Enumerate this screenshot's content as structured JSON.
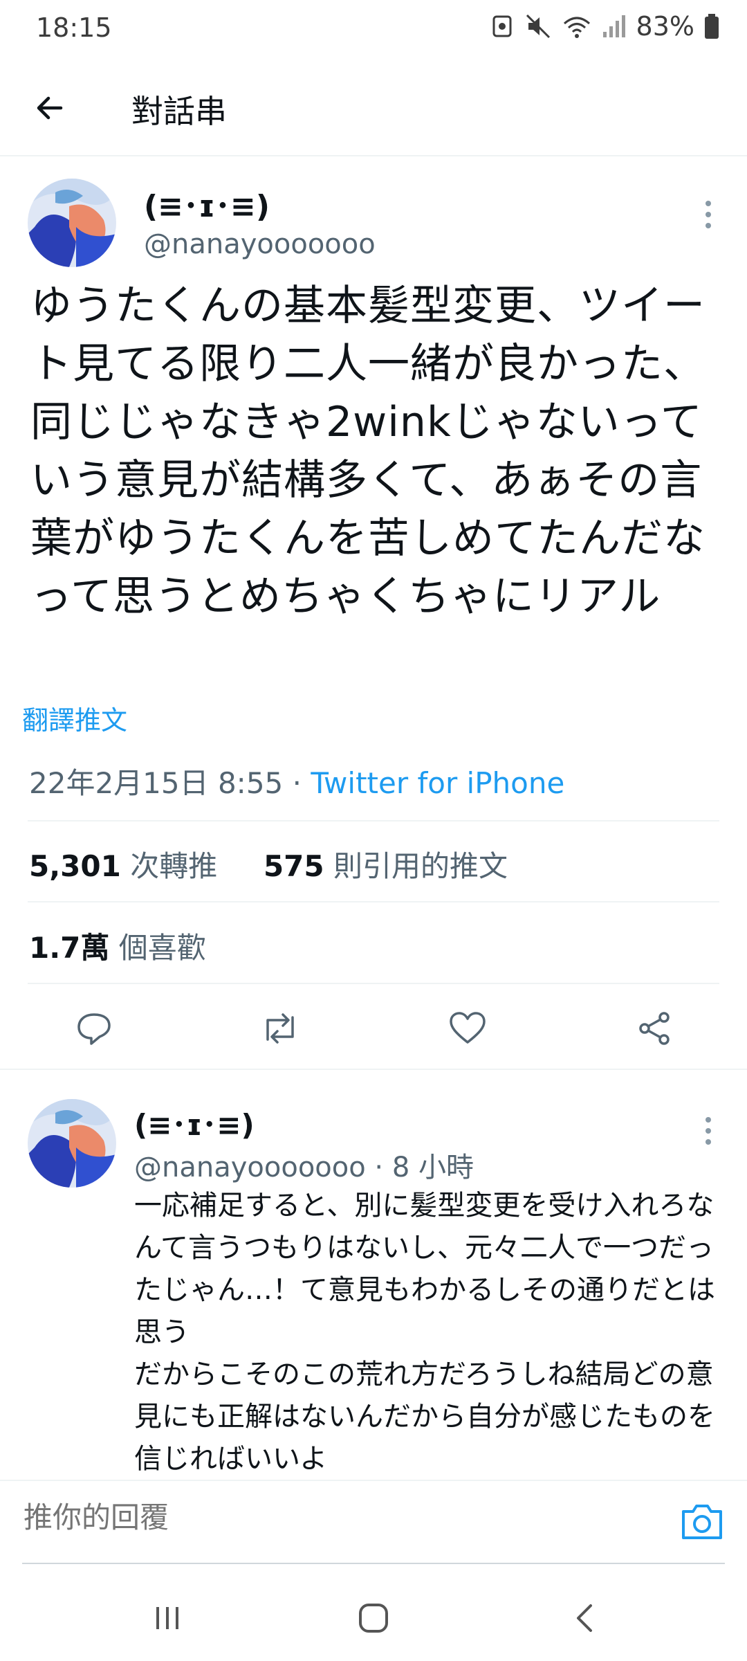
{
  "status_bar": {
    "time": "18:15",
    "battery": "83%"
  },
  "header": {
    "title": "對話串"
  },
  "main_tweet": {
    "name": "(≡･ɪ･≡)",
    "handle": "@nanayooooooo",
    "text": "ゆうたくんの基本髪型変更、ツイート見てる限り二人一緒が良かった、同じじゃなきゃ2winkじゃないっていう意見が結構多くて、あぁその言葉がゆうたくんを苦しめてたんだなって思うとめちゃくちゃにリアル",
    "translate_label": "翻譯推文",
    "date": "22年2月15日 8:55",
    "separator": " · ",
    "source": "Twitter for iPhone",
    "retweet_count": "5,301",
    "retweet_label": "次轉推",
    "quote_count": "575",
    "quote_label": "則引用的推文",
    "like_count": "1.7萬",
    "like_label": "個喜歡"
  },
  "reply_tweet": {
    "name": "(≡･ɪ･≡)",
    "handle": "@nanayooooooo",
    "separator": " · ",
    "time": "8 小時",
    "text": "一応補足すると、別に髪型変更を受け入れろなんて言うつもりはないし、元々二人で一つだったじゃん…！て意見もわかるしその通りだとは思う\nだからこそのこの荒れ方だろうしね結局どの意見にも正解はないんだから自分が感じたものを信じればいいよ"
  },
  "compose": {
    "placeholder": "推你的回覆"
  },
  "icons": {
    "back": "arrow-left-icon",
    "more": "more-vertical-icon",
    "reply": "comment-icon",
    "retweet": "retweet-icon",
    "like": "heart-icon",
    "share": "share-icon",
    "camera": "camera-icon"
  },
  "colors": {
    "accent": "#1d9bf0",
    "secondary_text": "#536471",
    "primary_text": "#0f1419",
    "divider": "#eff3f4"
  }
}
